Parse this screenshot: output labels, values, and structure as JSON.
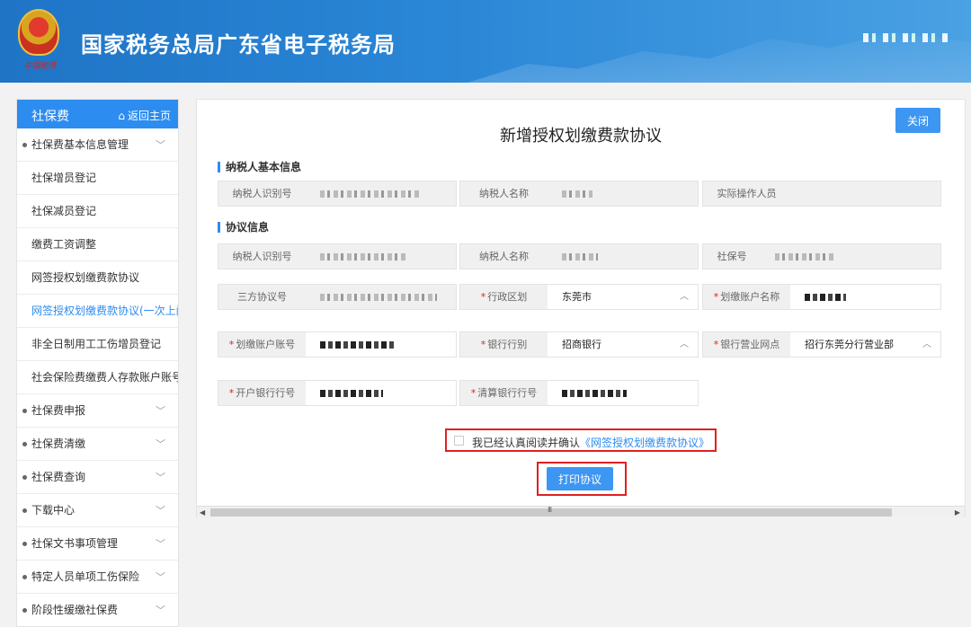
{
  "header": {
    "title": "国家税务总局广东省电子税务局",
    "emblem_text": "中国税务",
    "user_masked": "·'·. ! :·:"
  },
  "sidebar": {
    "title": "社保费",
    "home_label": "返回主页",
    "items": [
      {
        "label": "社保费基本信息管理",
        "bullet": true,
        "chevron": true
      },
      {
        "label": "社保增员登记",
        "bullet": false,
        "chevron": false
      },
      {
        "label": "社保减员登记",
        "bullet": false,
        "chevron": false
      },
      {
        "label": "缴费工资调整",
        "bullet": false,
        "chevron": false
      },
      {
        "label": "网签授权划缴费款协议",
        "bullet": false,
        "chevron": false
      },
      {
        "label": "网签授权划缴费款协议(一次上门",
        "bullet": false,
        "chevron": false,
        "active": true
      },
      {
        "label": "非全日制用工工伤增员登记",
        "bullet": false,
        "chevron": false
      },
      {
        "label": "社会保险费缴费人存款账户账号",
        "bullet": false,
        "chevron": false
      },
      {
        "label": "社保费申报",
        "bullet": true,
        "chevron": true
      },
      {
        "label": "社保费清缴",
        "bullet": true,
        "chevron": true
      },
      {
        "label": "社保费查询",
        "bullet": true,
        "chevron": true
      },
      {
        "label": "下载中心",
        "bullet": true,
        "chevron": true
      },
      {
        "label": "社保文书事项管理",
        "bullet": true,
        "chevron": true
      },
      {
        "label": "特定人员单项工伤保险",
        "bullet": true,
        "chevron": true
      },
      {
        "label": "阶段性缓缴社保费",
        "bullet": true,
        "chevron": true
      }
    ]
  },
  "panel": {
    "close_label": "关闭",
    "title": "新增授权划缴费款协议",
    "section_basic": "纳税人基本信息",
    "section_agreement": "协议信息",
    "basic": {
      "taxpayer_id_label": "纳税人识别号",
      "taxpayer_name_label": "纳税人名称",
      "operator_label": "实际操作人员"
    },
    "agreement": {
      "taxpayer_id_label": "纳税人识别号",
      "taxpayer_name_label": "纳税人名称",
      "social_no_label": "社保号",
      "tripartite_label": "三方协议号",
      "district_label": "行政区划",
      "district_value": "东莞市",
      "account_name_label": "划缴账户名称",
      "account_no_label": "划缴账户账号",
      "bank_type_label": "银行行别",
      "bank_type_value": "招商银行",
      "branch_label": "银行营业网点",
      "branch_value": "招行东莞分行营业部",
      "open_bank_label": "开户银行行号",
      "clearing_bank_label": "清算银行行号"
    },
    "agree_prefix": "我已经认真阅读并确认",
    "agree_link": "《网签授权划缴费款协议》",
    "print_label": "打印协议",
    "scroll_grip": "III"
  }
}
